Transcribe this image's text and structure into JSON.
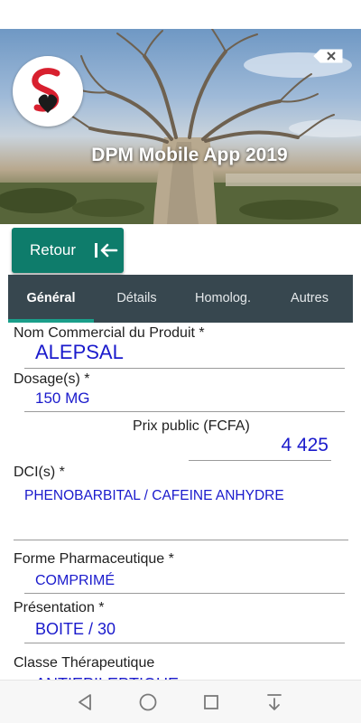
{
  "header": {
    "app_title": "DPM Mobile App 2019",
    "icons": {
      "logo": "pharmacy-logo",
      "close": "backspace-close-icon"
    }
  },
  "toolbar": {
    "back_label": "Retour",
    "back_icon": "arrow-left-to-bar-icon"
  },
  "tabs": [
    {
      "label": "Général",
      "active": true
    },
    {
      "label": "Détails",
      "active": false
    },
    {
      "label": "Homolog.",
      "active": false
    },
    {
      "label": "Autres",
      "active": false
    }
  ],
  "form": {
    "nom_commercial": {
      "label": "Nom Commercial du Produit *",
      "value": "ALEPSAL"
    },
    "dosage": {
      "label": "Dosage(s) *",
      "value": "150 MG"
    },
    "prix_public": {
      "label": "Prix public (FCFA)",
      "value": "4 425"
    },
    "dci": {
      "label": "DCI(s) *",
      "value": "PHENOBARBITAL / CAFEINE ANHYDRE"
    },
    "forme": {
      "label": "Forme Pharmaceutique *",
      "value": "COMPRIMÉ"
    },
    "presentation": {
      "label": "Présentation *",
      "value": "BOITE / 30"
    },
    "classe": {
      "label": "Classe Thérapeutique",
      "value": "ANTIEPILEPTIQUE"
    }
  },
  "nav_bar": {
    "icons": [
      "back-triangle-icon",
      "home-circle-icon",
      "recents-square-icon",
      "notifications-pulldown-icon"
    ]
  },
  "colors": {
    "accent": "#0e7c6b",
    "tab_bar": "#37474f",
    "tab_indicator": "#1a9e8a",
    "value_text": "#1a1acc"
  }
}
